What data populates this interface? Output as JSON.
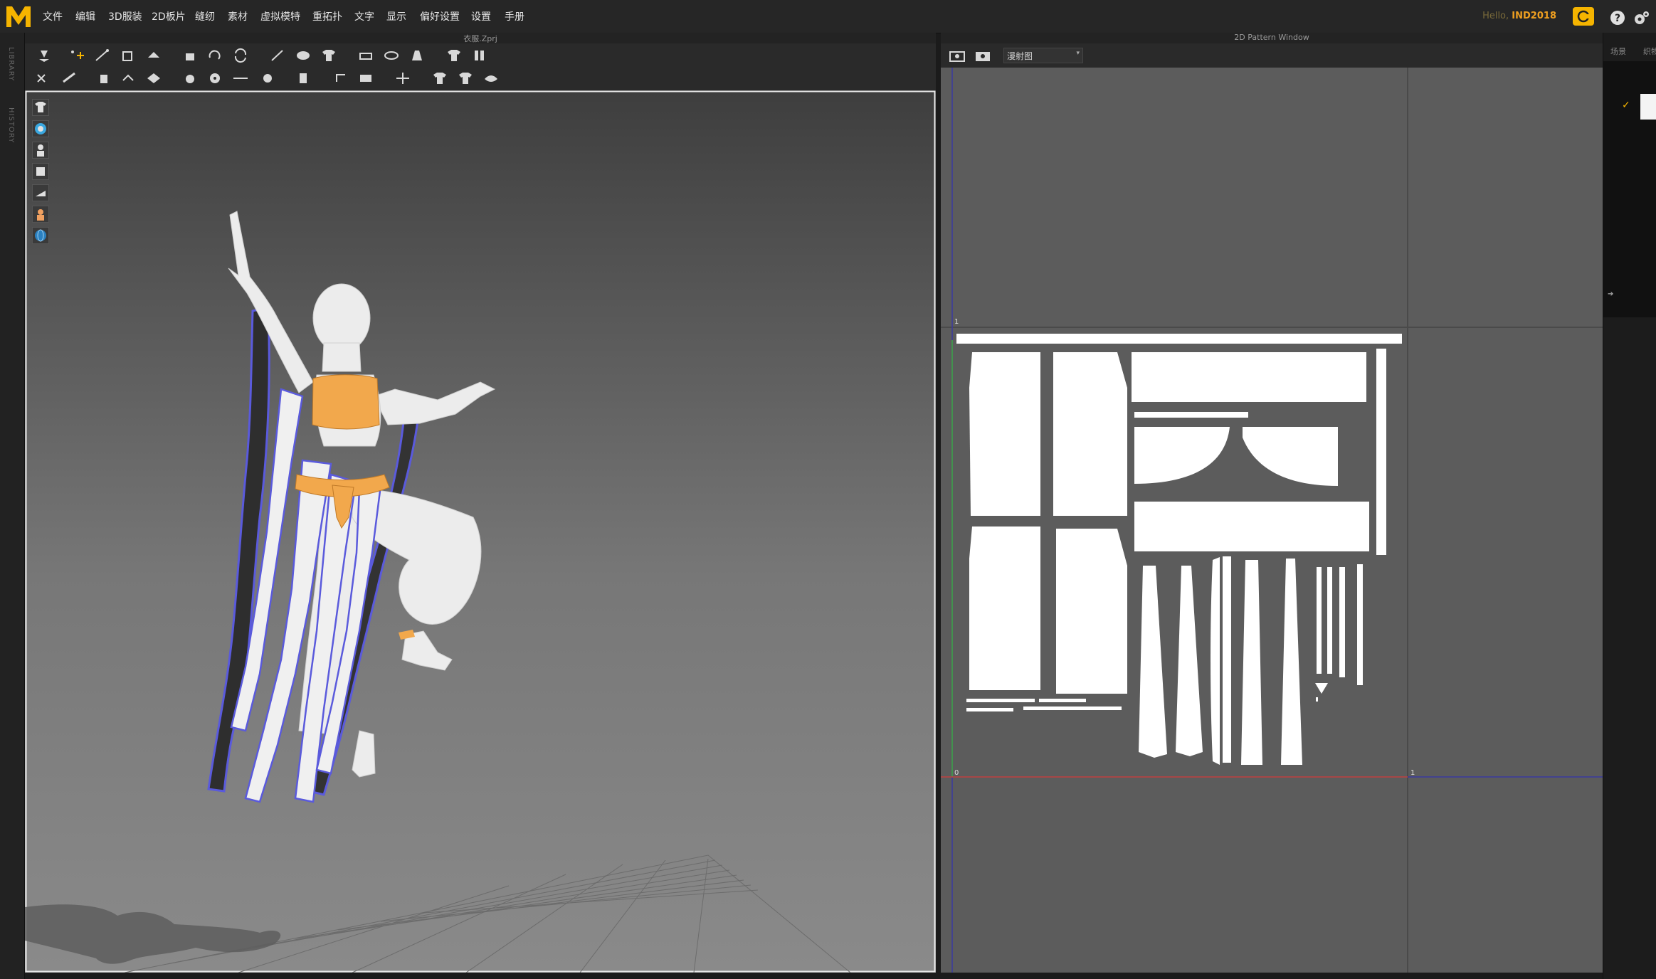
{
  "app": {
    "logo_letter": "M",
    "accent_color": "#f5b400",
    "menu": [
      "文件",
      "编辑",
      "3D服装",
      "2D板片",
      "缝纫",
      "素材",
      "虚拟模特",
      "重拓扑",
      "文字",
      "显示",
      "偏好设置",
      "设置",
      "手册"
    ],
    "hello_label": "Hello,",
    "user_name": "IND2018",
    "top_icons": [
      "cloud-icon",
      "help-icon",
      "settings-icon"
    ]
  },
  "left_strip": {
    "library_label": "LIBRARY",
    "history_label": "HISTORY"
  },
  "window3d": {
    "title": "衣服.Zprj",
    "garment_color": "#f2a84c",
    "outline_color": "#5a5adc",
    "side_tools": [
      "shirt-icon",
      "avatar-colored-icon",
      "avatar-icon",
      "texture-icon",
      "surface-icon",
      "skin-icon",
      "globe-icon"
    ],
    "toolbar_row1": [
      "select-icon",
      "move-icon",
      "transform-icon",
      "bounding-icon",
      "fold-icon",
      "arrange-icon",
      "reset-icon",
      "sync-icon",
      "pin-icon",
      "tack-icon",
      "shirt-icon",
      "arrange2-icon",
      "strap-icon",
      "avatar-icon",
      "shirt2-icon",
      "pattern-icon"
    ],
    "toolbar_row2": [
      "sew-icon",
      "seam-icon",
      "sew2-icon",
      "segment-icon",
      "free-sew-icon",
      "button-icon",
      "buttonhole-icon",
      "line-icon",
      "zipper-icon",
      "piping-icon",
      "puckering-icon",
      "layer-icon",
      "measure-icon",
      "avatar-measure-icon",
      "tape-icon",
      "fabric-icon"
    ]
  },
  "window2d": {
    "title": "2D Pattern Window",
    "view_mode": "漫射图",
    "axis_labels": {
      "origin": "0",
      "x_one": "1",
      "y_one": "1"
    }
  },
  "right_panel": {
    "tabs": [
      "场景",
      "织物"
    ]
  }
}
